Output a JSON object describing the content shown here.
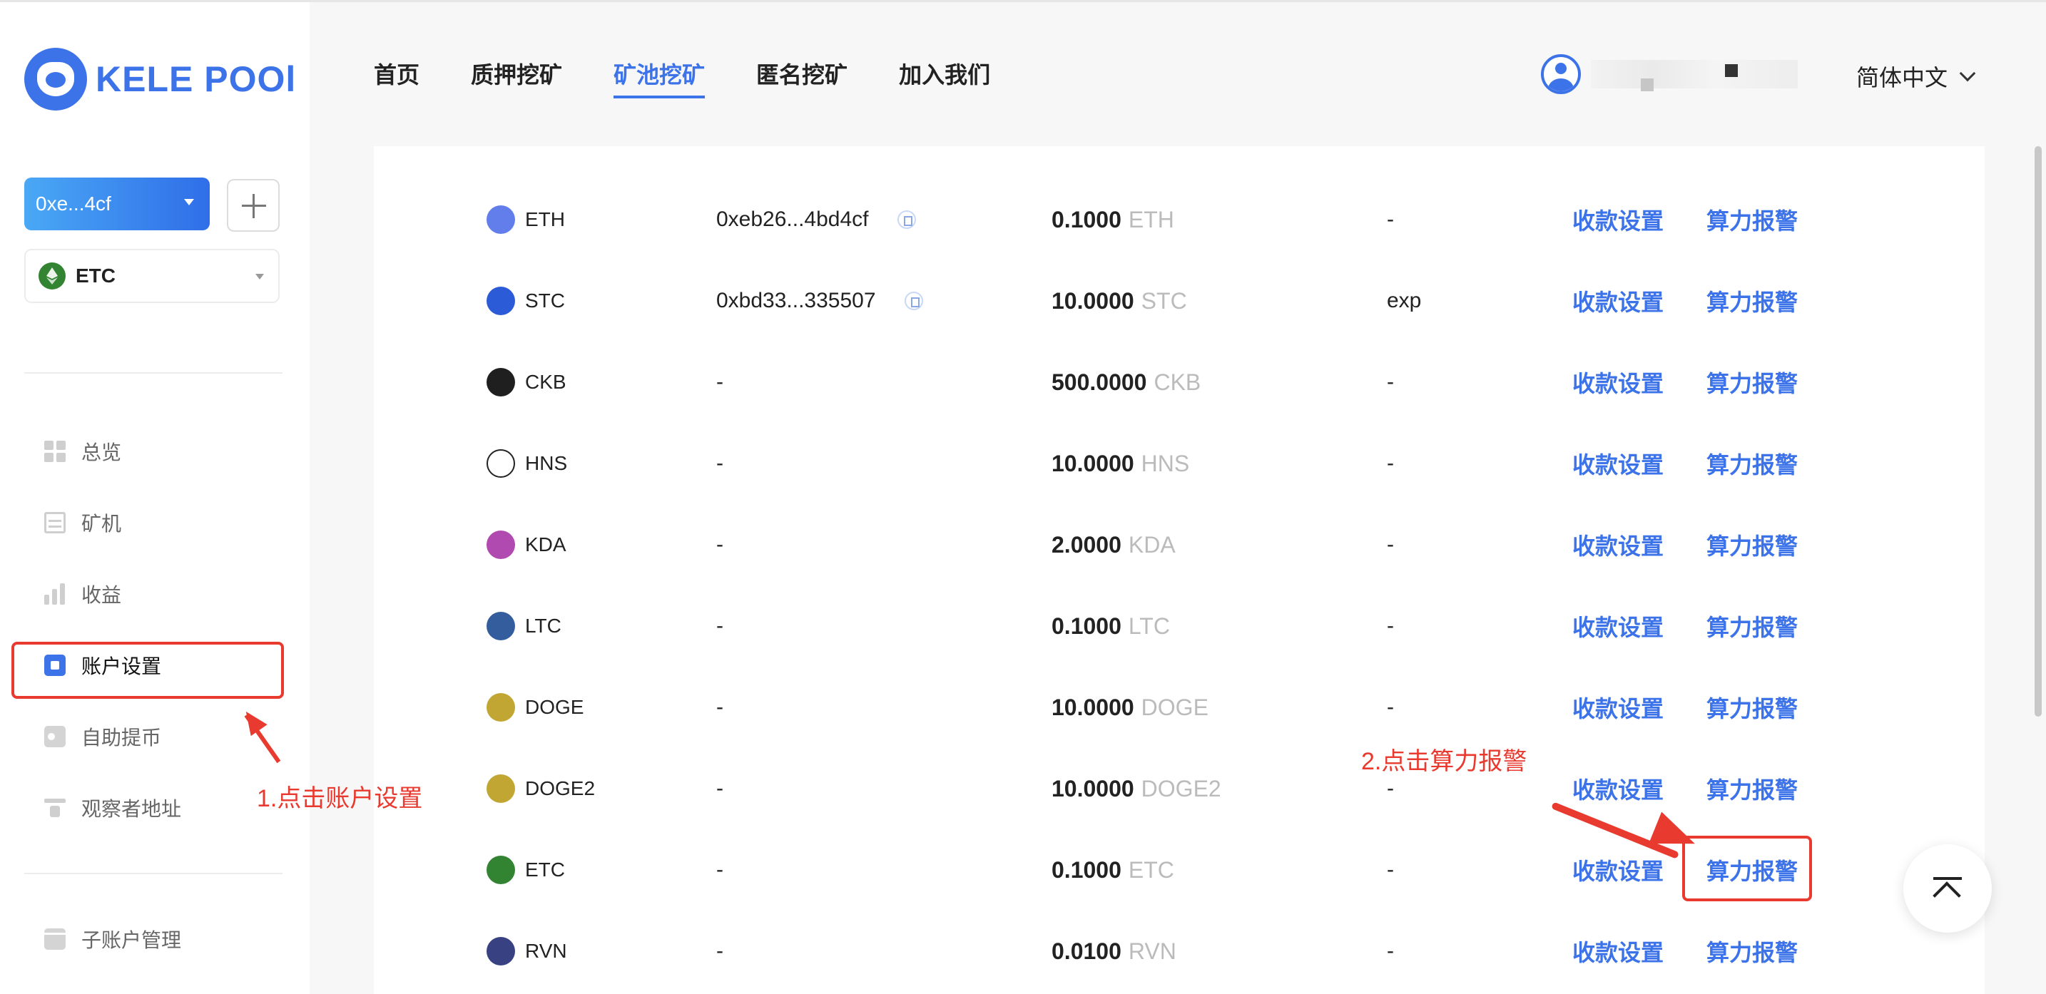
{
  "brand": {
    "name": "KELE POOl"
  },
  "sidebar": {
    "account_label": "0xe...4cf",
    "coin_select": "ETC",
    "items": [
      {
        "label": "总览",
        "icon": "dashboard-icon"
      },
      {
        "label": "矿机",
        "icon": "miner-icon"
      },
      {
        "label": "收益",
        "icon": "bar-chart-icon"
      },
      {
        "label": "账户设置",
        "icon": "account-settings-icon"
      },
      {
        "label": "自助提币",
        "icon": "wallet-icon"
      },
      {
        "label": "观察者地址",
        "icon": "watcher-icon"
      },
      {
        "label": "子账户管理",
        "icon": "sub-account-icon"
      }
    ]
  },
  "header": {
    "tabs": [
      "首页",
      "质押挖矿",
      "矿池挖矿",
      "匿名挖矿",
      "加入我们"
    ],
    "active_tab": "矿池挖矿",
    "language": "简体中文"
  },
  "annotations": {
    "step1": "1.点击账户设置",
    "step2": "2.点击算力报警"
  },
  "table": {
    "pay_label": "收款设置",
    "alarm_label": "算力报警",
    "rows": [
      {
        "coin": "ETH",
        "address": "0xeb26...4bd4cf",
        "min": "0.1000",
        "unit": "ETH",
        "remark": "-",
        "color": "#627eea"
      },
      {
        "coin": "STC",
        "address": "0xbd33...335507",
        "min": "10.0000",
        "unit": "STC",
        "remark": "exp",
        "color": "#2b5bd6"
      },
      {
        "coin": "CKB",
        "address": "-",
        "min": "500.0000",
        "unit": "CKB",
        "remark": "-",
        "color": "#1f1f1f"
      },
      {
        "coin": "HNS",
        "address": "-",
        "min": "10.0000",
        "unit": "HNS",
        "remark": "-",
        "color": "#ffffff"
      },
      {
        "coin": "KDA",
        "address": "-",
        "min": "2.0000",
        "unit": "KDA",
        "remark": "-",
        "color": "#b04ab0"
      },
      {
        "coin": "LTC",
        "address": "-",
        "min": "0.1000",
        "unit": "LTC",
        "remark": "-",
        "color": "#345d9d"
      },
      {
        "coin": "DOGE",
        "address": "-",
        "min": "10.0000",
        "unit": "DOGE",
        "remark": "-",
        "color": "#c2a633"
      },
      {
        "coin": "DOGE2",
        "address": "-",
        "min": "10.0000",
        "unit": "DOGE2",
        "remark": "-",
        "color": "#c2a633"
      },
      {
        "coin": "ETC",
        "address": "-",
        "min": "0.1000",
        "unit": "ETC",
        "remark": "-",
        "color": "#328332"
      },
      {
        "coin": "RVN",
        "address": "-",
        "min": "0.0100",
        "unit": "RVN",
        "remark": "-",
        "color": "#384182"
      }
    ]
  }
}
